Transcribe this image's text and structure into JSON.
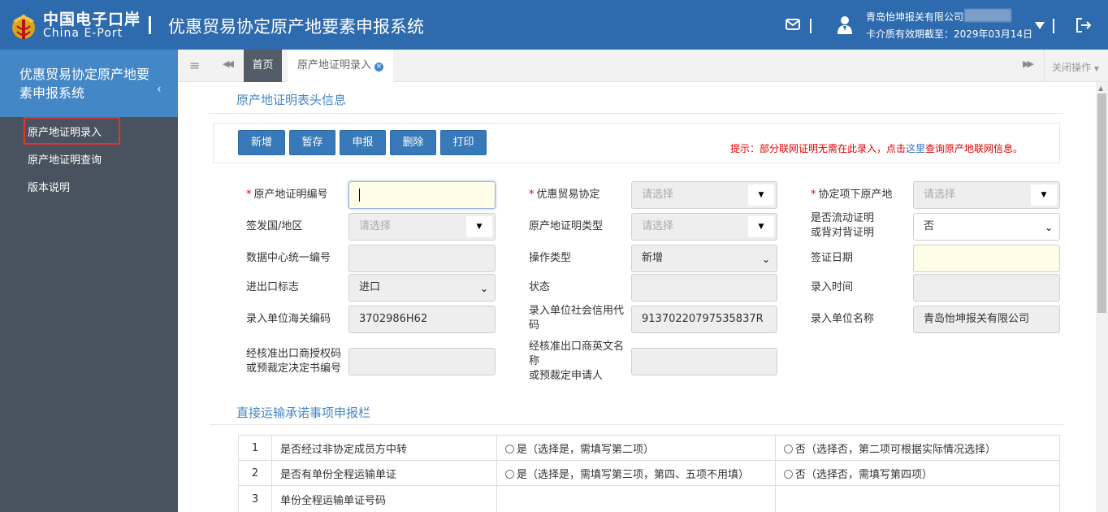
{
  "header": {
    "logo_cn": "中国电子口岸",
    "logo_en": "China E-Port",
    "system_title": "优惠贸易协定原产地要素申报系统",
    "user_company": "青岛怡坤报关有限公司",
    "card_expiry": "卡介质有效期截至：2029年03月14日"
  },
  "sidebar": {
    "title": "优惠贸易协定原产地要素申报系统",
    "items": [
      {
        "label": "原产地证明录入",
        "active": true
      },
      {
        "label": "原产地证明查询"
      },
      {
        "label": "版本说明"
      }
    ]
  },
  "tabs": {
    "home": "首页",
    "current": "原产地证明录入",
    "close_op": "关闭操作"
  },
  "form": {
    "section_title": "原产地证明表头信息",
    "buttons": [
      "新增",
      "暂存",
      "申报",
      "删除",
      "打印"
    ],
    "tip_prefix": "提示：部分联网证明无需在此录入，点击",
    "tip_link": "这里",
    "tip_suffix": "查询原产地联网信息。",
    "fields": {
      "cert_no_label": "原产地证明编号",
      "agreement_label": "优惠贸易协定",
      "agreement_placeholder": "请选择",
      "origin_label": "协定项下原产地",
      "origin_placeholder": "请选择",
      "issue_country_label": "签发国/地区",
      "issue_country_placeholder": "请选择",
      "cert_type_label": "原产地证明类型",
      "cert_type_placeholder": "请选择",
      "is_movement_label_1": "是否流动证明",
      "is_movement_label_2": "或背对背证明",
      "is_movement_value": "否",
      "datacenter_no_label": "数据中心统一编号",
      "op_type_label": "操作类型",
      "op_type_value": "新增",
      "visa_date_label": "签证日期",
      "ie_flag_label": "进出口标志",
      "ie_flag_value": "进口",
      "status_label": "状态",
      "input_time_label": "录入时间",
      "customs_code_label": "录入单位海关编码",
      "customs_code_value": "3702986H62",
      "credit_code_label_1": "录入单位社会信用代",
      "credit_code_label_2": "码",
      "credit_code_value": "91370220797535837R",
      "input_unit_label": "录入单位名称",
      "input_unit_value": "青岛怡坤报关有限公司",
      "approved_no_label_1": "经核准出口商授权码",
      "approved_no_label_2": "或预裁定决定书编号",
      "approved_en_label_1": "经核准出口商英文名",
      "approved_en_label_2": "称",
      "approved_en_label_3": "或预裁定申请人"
    }
  },
  "transport": {
    "section_title": "直接运输承诺事项申报栏",
    "rows": [
      {
        "num": "1",
        "question": "是否经过非协定成员方中转",
        "yes": "是（选择是，需填写第二项）",
        "no": "否（选择否，第二项可根据实际情况选择）"
      },
      {
        "num": "2",
        "question": "是否有单份全程运输单证",
        "yes": "是（选择是，需填写第三项，第四、五项不用填）",
        "no": "否（选择否，需填写第四项）"
      },
      {
        "num": "3",
        "question": "单份全程运输单证号码",
        "yes": "",
        "no": ""
      }
    ]
  }
}
